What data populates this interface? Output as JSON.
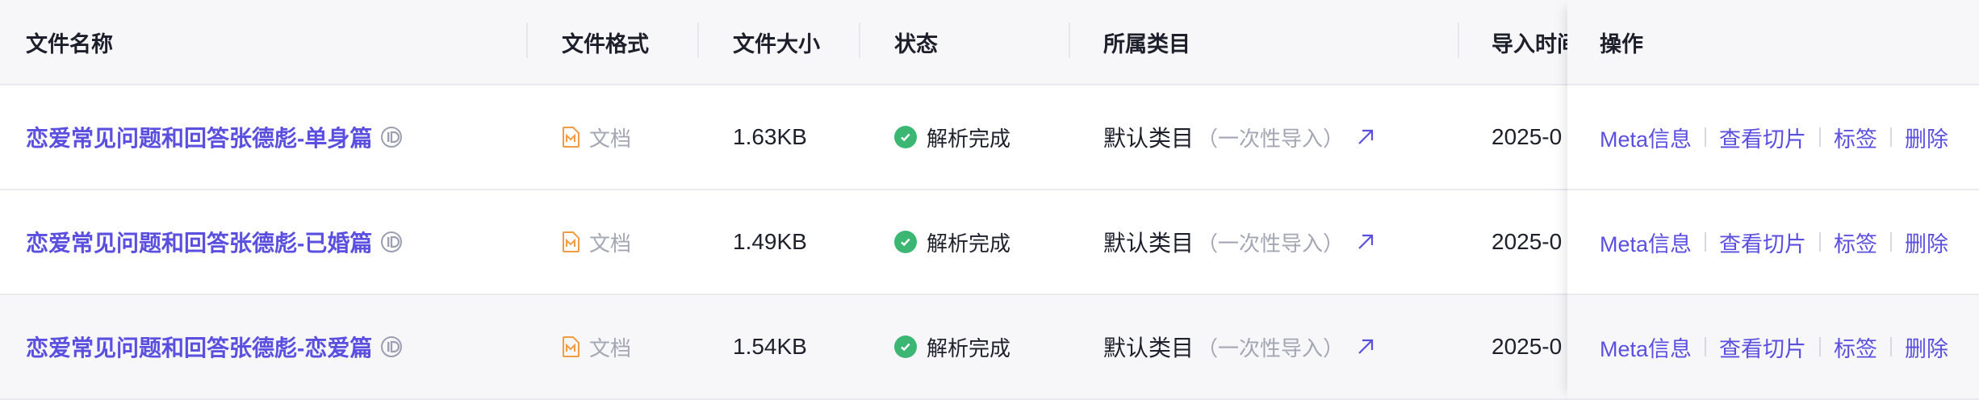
{
  "columns": {
    "name": "文件名称",
    "format": "文件格式",
    "size": "文件大小",
    "status": "状态",
    "category": "所属类目",
    "import_time": "导入时间",
    "actions": "操作"
  },
  "rows": [
    {
      "file_name": "恋爱常见问题和回答张德彪-单身篇",
      "format": "文档",
      "size": "1.63KB",
      "status": "解析完成",
      "category": "默认类目",
      "category_note": "（一次性导入）",
      "import_time": "2025-0"
    },
    {
      "file_name": "恋爱常见问题和回答张德彪-已婚篇",
      "format": "文档",
      "size": "1.49KB",
      "status": "解析完成",
      "category": "默认类目",
      "category_note": "（一次性导入）",
      "import_time": "2025-0"
    },
    {
      "file_name": "恋爱常见问题和回答张德彪-恋爱篇",
      "format": "文档",
      "size": "1.54KB",
      "status": "解析完成",
      "category": "默认类目",
      "category_note": "（一次性导入）",
      "import_time": "2025-0"
    }
  ],
  "actions": {
    "meta": "Meta信息",
    "view_chunks": "查看切片",
    "tags": "标签",
    "delete": "删除"
  },
  "icons": {
    "id": "id-icon",
    "format": "document-icon",
    "status": "check-circle-icon",
    "jump": "arrow-up-right-icon"
  },
  "colors": {
    "link": "#5b4fe0",
    "status_success": "#3bb673",
    "format_icon": "#f29b45",
    "muted_text": "#a3a6b3",
    "header_bg": "#f7f7fa"
  }
}
